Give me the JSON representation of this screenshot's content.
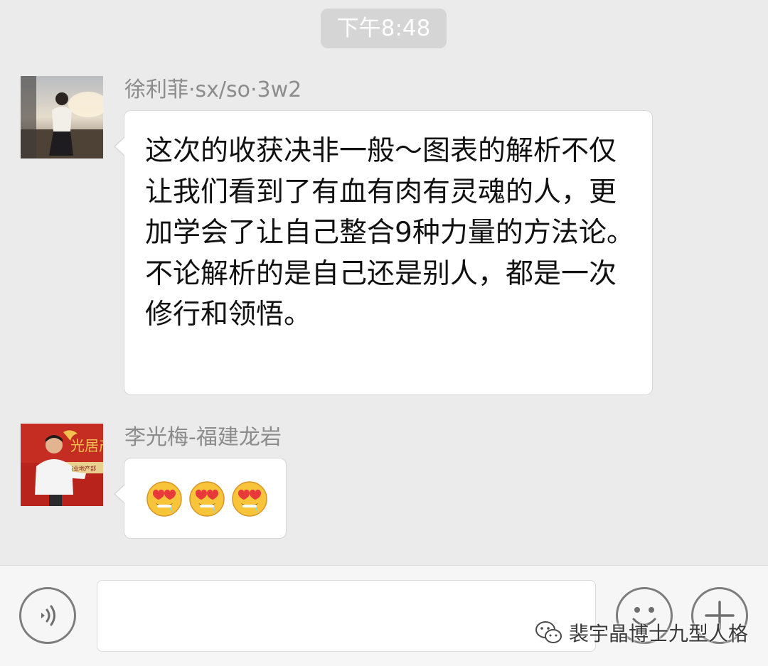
{
  "time_divider": "下午8:48",
  "messages": [
    {
      "sender": "徐利菲·sx/so·3w2",
      "text": "这次的收获决非一般～图表的解析不仅让我们看到了有血有肉有灵魂的人，更加学会了让自己整合9种力量的方法论。不论解析的是自己还是别人，都是一次修行和领悟。"
    },
    {
      "sender": "李光梅-福建龙岩",
      "emojis": [
        "heart-eyes-drooling-emoji",
        "heart-eyes-drooling-emoji",
        "heart-eyes-drooling-emoji"
      ]
    }
  ],
  "avatar2_sign": {
    "line1": "光居产",
    "line2": "商业地产部"
  },
  "input_bar": {
    "voice_icon": "voice-wave-icon",
    "emoji_icon": "smiley-face-icon",
    "plus_icon": "plus-icon",
    "input_value": ""
  },
  "watermark": {
    "text": "裴宇晶博士九型人格",
    "icon": "wechat-icon"
  },
  "colors": {
    "background": "#ebebeb",
    "bubble": "#ffffff",
    "name": "#8c8c8c",
    "time_pill": "#d5d5d5",
    "input_bar": "#f6f6f6"
  }
}
